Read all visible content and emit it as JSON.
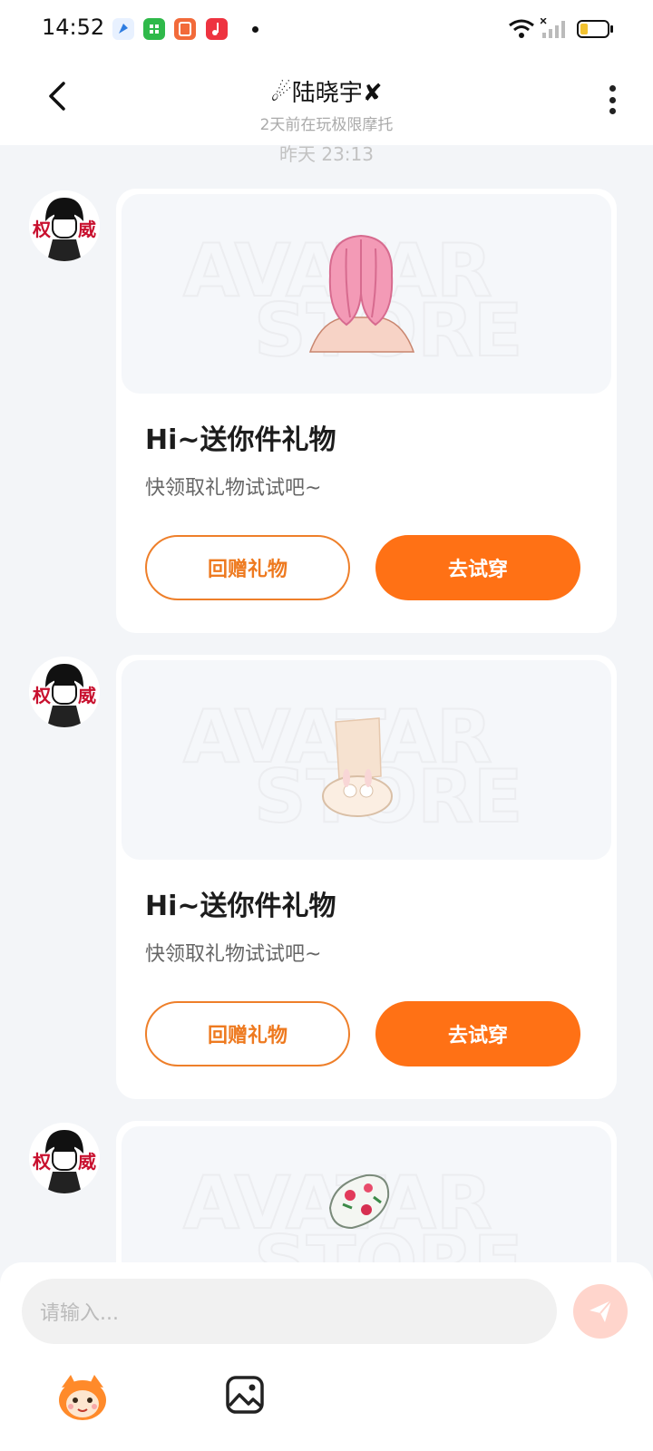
{
  "status_bar": {
    "time": "14:52"
  },
  "header": {
    "title": "☄陆晓宇✘",
    "subtitle": "2天前在玩极限摩托"
  },
  "chat": {
    "timestamp": "昨天 23:13",
    "messages": [
      {
        "title": "Hi~送你件礼物",
        "subtitle": "快领取礼物试试吧~",
        "reply_label": "回赠礼物",
        "try_label": "去试穿",
        "gift": "pink-hair-icon"
      },
      {
        "title": "Hi~送你件礼物",
        "subtitle": "快领取礼物试试吧~",
        "reply_label": "回赠礼物",
        "try_label": "去试穿",
        "gift": "bunny-slippers-icon"
      },
      {
        "gift": "floral-hat-icon"
      }
    ]
  },
  "input": {
    "placeholder": "请输入..."
  },
  "colors": {
    "accent": "#ff7115",
    "outline": "#ee7f2a",
    "background": "#f3f5f8"
  }
}
